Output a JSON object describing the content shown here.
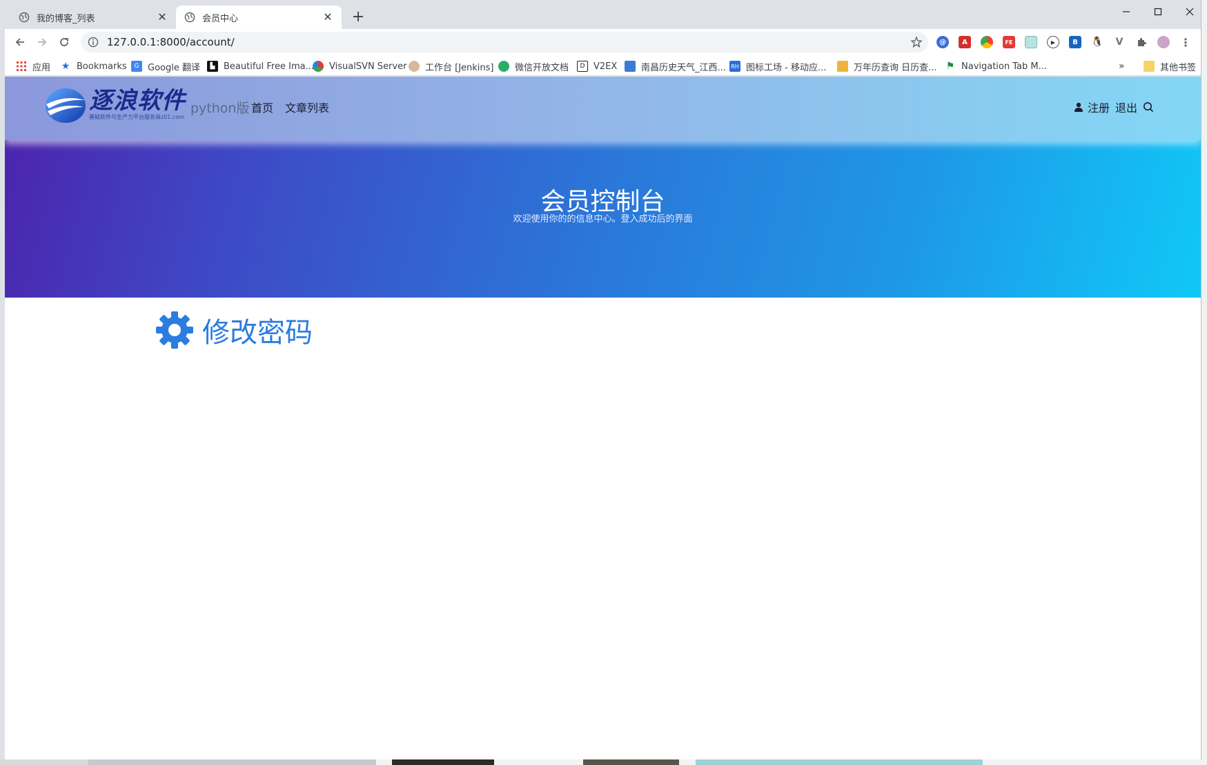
{
  "browser": {
    "tabs": [
      {
        "title": "我的博客_列表",
        "active": false
      },
      {
        "title": "会员中心",
        "active": true
      }
    ],
    "url": "127.0.0.1:8000/account/",
    "bookmarks": [
      {
        "label": "应用",
        "icon": "apps-grid-icon"
      },
      {
        "label": "Bookmarks",
        "icon": "star-icon"
      },
      {
        "label": "Google 翻译",
        "icon": "google-translate-icon"
      },
      {
        "label": "Beautiful Free Ima...",
        "icon": "unsplash-icon"
      },
      {
        "label": "VisualSVN Server",
        "icon": "visualsvn-icon"
      },
      {
        "label": "工作台 [Jenkins]",
        "icon": "jenkins-icon"
      },
      {
        "label": "微信开放文档",
        "icon": "wechat-icon"
      },
      {
        "label": "V2EX",
        "icon": "v2ex-icon"
      },
      {
        "label": "南昌历史天气_江西...",
        "icon": "weather-icon"
      },
      {
        "label": "图标工场 - 移动应...",
        "icon": "rh-icon"
      },
      {
        "label": "万年历查询 日历查...",
        "icon": "calendar-icon"
      },
      {
        "label": "Navigation Tab M...",
        "icon": "navigation-tab-icon"
      }
    ],
    "other_bookmarks": "其他书签",
    "overflow": "»"
  },
  "site": {
    "logo_name": "逐浪软件",
    "logo_tagline": "基础软件与生产力平台服务商z01.com",
    "logo_sub": "python版",
    "nav": {
      "home": "首页",
      "articles": "文章列表"
    },
    "user_nav": {
      "register": "注册",
      "logout": "退出"
    }
  },
  "hero": {
    "title": "会员控制台",
    "subtitle": "欢迎使用你的的信息中心。登入成功后的界面"
  },
  "section": {
    "heading": "修改密码"
  },
  "colors": {
    "accent": "#2b7ce0",
    "hero_start": "#4c22ab",
    "hero_end": "#10c8f8",
    "logo": "#1a2a8c"
  }
}
